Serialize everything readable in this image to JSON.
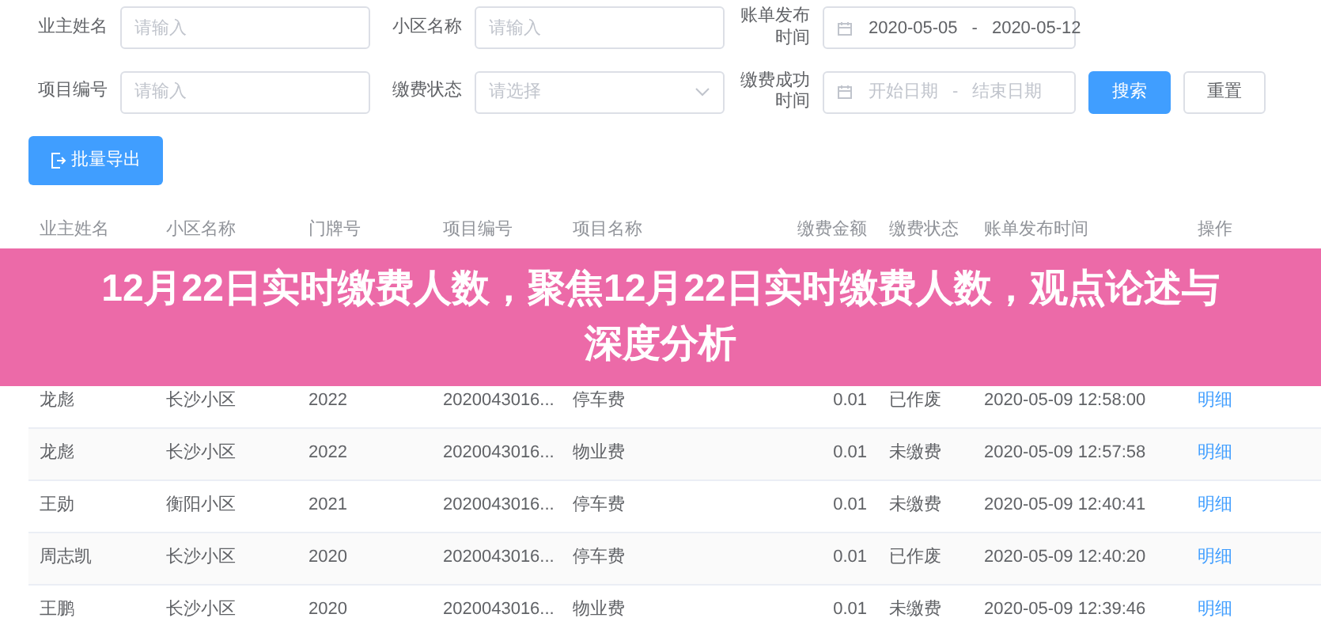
{
  "filters": [
    {
      "label": "业主姓名",
      "kind": "text",
      "placeholder": "请输入"
    },
    {
      "label": "小区名称",
      "kind": "text",
      "placeholder": "请输入"
    },
    {
      "label": "账单发布时间",
      "kind": "daterange",
      "start": "2020-05-05",
      "separator": "-",
      "end": "2020-05-12"
    },
    {
      "label": "项目编号",
      "kind": "text",
      "placeholder": "请输入"
    },
    {
      "label": "缴费状态",
      "kind": "select",
      "placeholder": "请选择"
    },
    {
      "label": "缴费成功时间",
      "kind": "daterange",
      "start_placeholder": "开始日期",
      "separator": "-",
      "end_placeholder": "结束日期"
    }
  ],
  "buttons": [
    {
      "label": "搜索",
      "kind": "primary"
    },
    {
      "label": "重置",
      "kind": "default"
    }
  ],
  "export_button": "批量导出",
  "table": {
    "columns": [
      "业主姓名",
      "小区名称",
      "门牌号",
      "项目编号",
      "项目名称",
      "缴费金额",
      "缴费状态",
      "账单发布时间",
      "操作"
    ],
    "rows": [
      {
        "owner": "龙彪",
        "community": "长沙小区",
        "door": "2022",
        "project_no": "2020043016...",
        "project_name": "停车费",
        "amount": "0.01",
        "status": "已作废",
        "time": "2020-05-09 12:58:00",
        "action": "明细"
      },
      {
        "owner": "龙彪",
        "community": "长沙小区",
        "door": "2022",
        "project_no": "2020043016...",
        "project_name": "物业费",
        "amount": "0.01",
        "status": "未缴费",
        "time": "2020-05-09 12:57:58",
        "action": "明细"
      },
      {
        "owner": "王勋",
        "community": "衡阳小区",
        "door": "2021",
        "project_no": "2020043016...",
        "project_name": "停车费",
        "amount": "0.01",
        "status": "未缴费",
        "time": "2020-05-09 12:40:41",
        "action": "明细"
      },
      {
        "owner": "周志凯",
        "community": "长沙小区",
        "door": "2020",
        "project_no": "2020043016...",
        "project_name": "停车费",
        "amount": "0.01",
        "status": "已作废",
        "time": "2020-05-09 12:40:20",
        "action": "明细"
      },
      {
        "owner": "王鹏",
        "community": "长沙小区",
        "door": "2020",
        "project_no": "2020043016...",
        "project_name": "物业费",
        "amount": "0.01",
        "status": "未缴费",
        "time": "2020-05-09 12:39:46",
        "action": "明细"
      }
    ]
  },
  "banner": {
    "title": "12月22日实时缴费人数，聚焦12月22日实时缴费人数，观点论述与深度分析"
  }
}
